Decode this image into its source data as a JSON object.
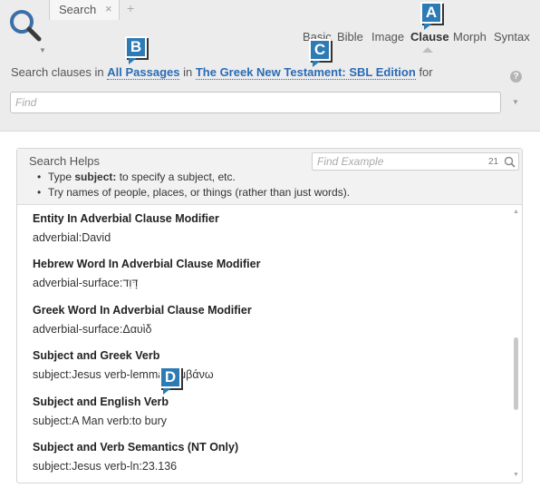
{
  "tab": {
    "label": "Search",
    "close": "×",
    "add": "+"
  },
  "modes": [
    {
      "label": "Basic",
      "active": false
    },
    {
      "label": "Bible",
      "active": false
    },
    {
      "label": "Image",
      "active": false
    },
    {
      "label": "Clause",
      "active": true
    },
    {
      "label": "Morph",
      "active": false
    },
    {
      "label": "Syntax",
      "active": false
    }
  ],
  "scope": {
    "prefix": "Search clauses in",
    "passages": "All Passages",
    "mid": "in",
    "resource": "The Greek New Testament: SBL Edition",
    "suffix": "for"
  },
  "find": {
    "placeholder": "Find",
    "value": ""
  },
  "help": {
    "icon_label": "?"
  },
  "search_helps": {
    "title": "Search Helps",
    "example_placeholder": "Find Example",
    "example_count": "21",
    "tip1_prefix": "Type",
    "tip1_keyword": "subject:",
    "tip1_suffix": "to specify a subject, etc.",
    "tip2": "Try names of people, places, or things (rather than just words)."
  },
  "examples": [
    {
      "title": "Entity In Adverbial Clause Modifier",
      "query": "adverbial:David"
    },
    {
      "title": "Hebrew Word In Adverbial Clause Modifier",
      "query": "adverbial-surface:דָּוִד"
    },
    {
      "title": "Greek Word In Adverbial Clause Modifier",
      "query": "adverbial-surface:Δαυὶδ"
    },
    {
      "title": "Subject and Greek Verb",
      "query": "subject:Jesus verb-lemma:λαμβάνω"
    },
    {
      "title": "Subject and English Verb",
      "query": "subject:A Man verb:to bury"
    },
    {
      "title": "Subject and Verb Semantics (NT Only)",
      "query": "subject:Jesus verb-ln:23.136"
    }
  ],
  "callouts": {
    "a": "A",
    "b": "B",
    "c": "C",
    "d": "D"
  },
  "colors": {
    "link": "#2a6bb5",
    "callout": "#2d7bb5",
    "panel": "#ececec"
  }
}
